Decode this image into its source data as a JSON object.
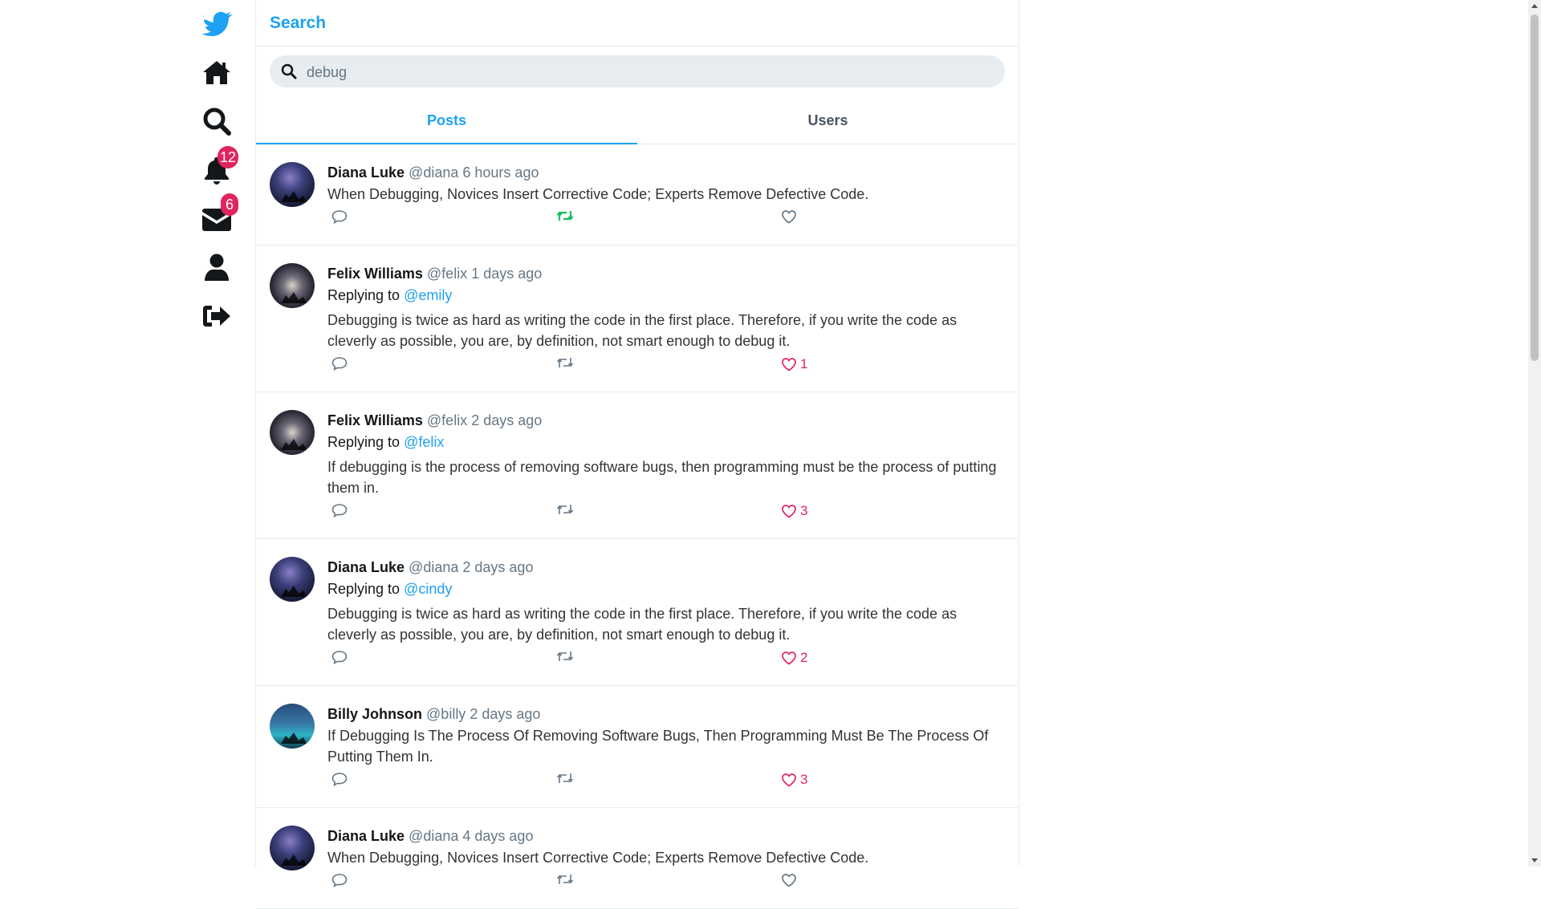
{
  "page": {
    "title": "Search"
  },
  "nav": {
    "items": [
      {
        "name": "logo",
        "icon": "bird-logo-icon"
      },
      {
        "name": "home",
        "icon": "home-icon"
      },
      {
        "name": "search",
        "icon": "search-icon"
      },
      {
        "name": "notifications",
        "icon": "bell-icon",
        "badge": "12"
      },
      {
        "name": "messages",
        "icon": "envelope-icon",
        "badge": "6"
      },
      {
        "name": "profile",
        "icon": "user-icon"
      },
      {
        "name": "logout",
        "icon": "sign-out-icon"
      }
    ]
  },
  "search": {
    "value": "debug",
    "placeholder": ""
  },
  "tabs": [
    {
      "label": "Posts",
      "active": true
    },
    {
      "label": "Users",
      "active": false
    }
  ],
  "colors": {
    "accent": "#1da1f2",
    "like": "#e0245e",
    "retweeted": "#17bf63",
    "badge": "#e0245e"
  },
  "posts": [
    {
      "author": "Diana Luke",
      "handle": "@diana",
      "time": "6 hours ago",
      "reply_prefix": "",
      "reply_to": "",
      "text": "When Debugging, Novices Insert Corrective Code; Experts Remove Defective Code.",
      "likes": "",
      "retweeted": true
    },
    {
      "author": "Felix Williams",
      "handle": "@felix",
      "time": "1 days ago",
      "reply_prefix": "Replying to",
      "reply_to": "@emily",
      "text": "Debugging is twice as hard as writing the code in the first place. Therefore, if you write the code as cleverly as possible, you are, by definition, not smart enough to debug it.",
      "likes": "1",
      "retweeted": false
    },
    {
      "author": "Felix Williams",
      "handle": "@felix",
      "time": "2 days ago",
      "reply_prefix": "Replying to",
      "reply_to": "@felix",
      "text": "If debugging is the process of removing software bugs, then programming must be the process of putting them in.",
      "likes": "3",
      "retweeted": false
    },
    {
      "author": "Diana Luke",
      "handle": "@diana",
      "time": "2 days ago",
      "reply_prefix": "Replying to",
      "reply_to": "@cindy",
      "text": "Debugging is twice as hard as writing the code in the first place. Therefore, if you write the code as cleverly as possible, you are, by definition, not smart enough to debug it.",
      "likes": "2",
      "retweeted": false
    },
    {
      "author": "Billy Johnson",
      "handle": "@billy",
      "time": "2 days ago",
      "reply_prefix": "",
      "reply_to": "",
      "text": "If Debugging Is The Process Of Removing Software Bugs, Then Programming Must Be The Process Of Putting Them In.",
      "likes": "3",
      "retweeted": false
    },
    {
      "author": "Diana Luke",
      "handle": "@diana",
      "time": "4 days ago",
      "reply_prefix": "",
      "reply_to": "",
      "text": "When Debugging, Novices Insert Corrective Code; Experts Remove Defective Code.",
      "likes": "",
      "retweeted": false
    }
  ]
}
